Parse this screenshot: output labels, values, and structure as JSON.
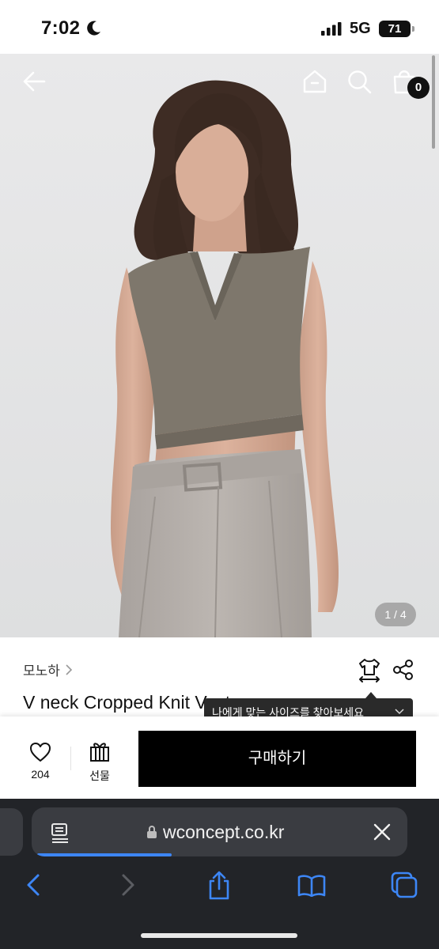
{
  "status_bar": {
    "time": "7:02",
    "network": "5G",
    "battery": "71"
  },
  "product_view": {
    "cart_count": "0",
    "pager": "1 / 4"
  },
  "product": {
    "brand": "모노하",
    "title": "V neck Cropped Knit Vest",
    "size_tooltip": "나에게 맞는 사이즈를 찾아보세요",
    "like_count": "204",
    "gift_label": "선물",
    "buy_label": "구매하기"
  },
  "browser": {
    "url": "wconcept.co.kr",
    "accent_color": "#3d86f5"
  },
  "icons": [
    "moon-icon",
    "signal-icon",
    "back-arrow-icon",
    "home-icon",
    "search-icon",
    "cart-icon",
    "size-guide-icon",
    "share-icon",
    "heart-icon",
    "gift-icon",
    "reader-icon",
    "lock-icon",
    "close-icon",
    "back-icon",
    "forward-icon",
    "share-sheet-icon",
    "bookmarks-icon",
    "tabs-icon"
  ]
}
